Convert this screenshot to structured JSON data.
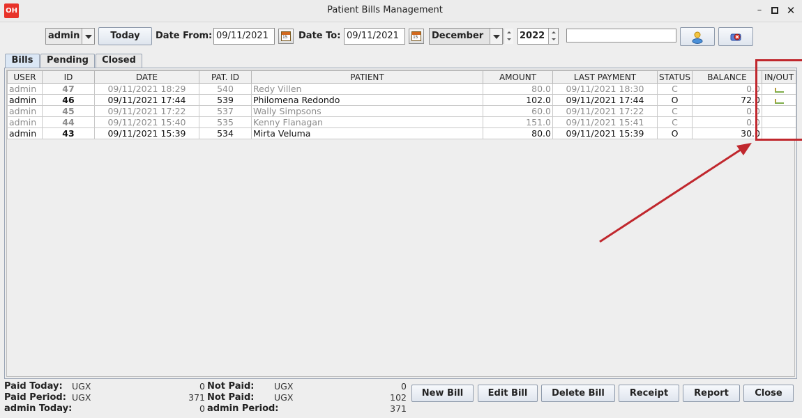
{
  "window": {
    "title": "Patient Bills Management",
    "logo": "OH"
  },
  "toolbar": {
    "user_value": "admin",
    "today_label": "Today",
    "date_from_label": "Date From:",
    "date_from_value": "09/11/2021",
    "date_to_label": "Date To:",
    "date_to_value": "09/11/2021",
    "month_value": "December",
    "year_value": "2022",
    "search_value": ""
  },
  "tabs": [
    {
      "label": "Bills"
    },
    {
      "label": "Pending"
    },
    {
      "label": "Closed"
    }
  ],
  "table": {
    "headers": [
      "USER",
      "ID",
      "DATE",
      "PAT. ID",
      "PATIENT",
      "AMOUNT",
      "LAST PAYMENT",
      "STATUS",
      "BALANCE",
      "IN/OUT"
    ],
    "rows": [
      {
        "user": "admin",
        "id": "47",
        "date": "09/11/2021 18:29",
        "pat_id": "540",
        "patient": "Redy Villen",
        "amount": "80.0",
        "last_payment": "09/11/2021 18:30",
        "status": "C",
        "balance": "0.0",
        "inout": "in-out-icon",
        "state": "closed"
      },
      {
        "user": "admin",
        "id": "46",
        "date": "09/11/2021 17:44",
        "pat_id": "539",
        "patient": "Philomena Redondo",
        "amount": "102.0",
        "last_payment": "09/11/2021 17:44",
        "status": "O",
        "balance": "72.0",
        "inout": "in-out-icon",
        "state": "open"
      },
      {
        "user": "admin",
        "id": "45",
        "date": "09/11/2021 17:22",
        "pat_id": "537",
        "patient": "Wally Simpsons",
        "amount": "60.0",
        "last_payment": "09/11/2021 17:22",
        "status": "C",
        "balance": "0.0",
        "inout": "",
        "state": "closed"
      },
      {
        "user": "admin",
        "id": "44",
        "date": "09/11/2021 15:40",
        "pat_id": "535",
        "patient": "Kenny Flanagan",
        "amount": "151.0",
        "last_payment": "09/11/2021 15:41",
        "status": "C",
        "balance": "0.0",
        "inout": "",
        "state": "closed"
      },
      {
        "user": "admin",
        "id": "43",
        "date": "09/11/2021 15:39",
        "pat_id": "534",
        "patient": "Mirta Veluma",
        "amount": "80.0",
        "last_payment": "09/11/2021 15:39",
        "status": "O",
        "balance": "30.0",
        "inout": "",
        "state": "open"
      }
    ]
  },
  "summary": {
    "paid_today_label": "Paid Today:",
    "paid_today_currency": "UGX",
    "paid_today_value": "0",
    "paid_period_label": "Paid Period:",
    "paid_period_currency": "UGX",
    "paid_period_value": "371",
    "user_today_label": "admin Today:",
    "user_today_value": "0",
    "not_paid_label": "Not Paid:",
    "not_paid_currency": "UGX",
    "not_paid_value": "0",
    "not_paid2_label": "Not Paid:",
    "not_paid2_currency": "UGX",
    "not_paid2_value": "102",
    "user_period_label": "admin Period:",
    "user_period_value": "371"
  },
  "actions": {
    "new_bill": "New Bill",
    "edit_bill": "Edit Bill",
    "delete_bill": "Delete Bill",
    "receipt": "Receipt",
    "report": "Report",
    "close": "Close"
  },
  "colors": {
    "annotation": "#c0272d",
    "logo_bg": "#e8332a",
    "tab_active": "#dbe7f5"
  }
}
